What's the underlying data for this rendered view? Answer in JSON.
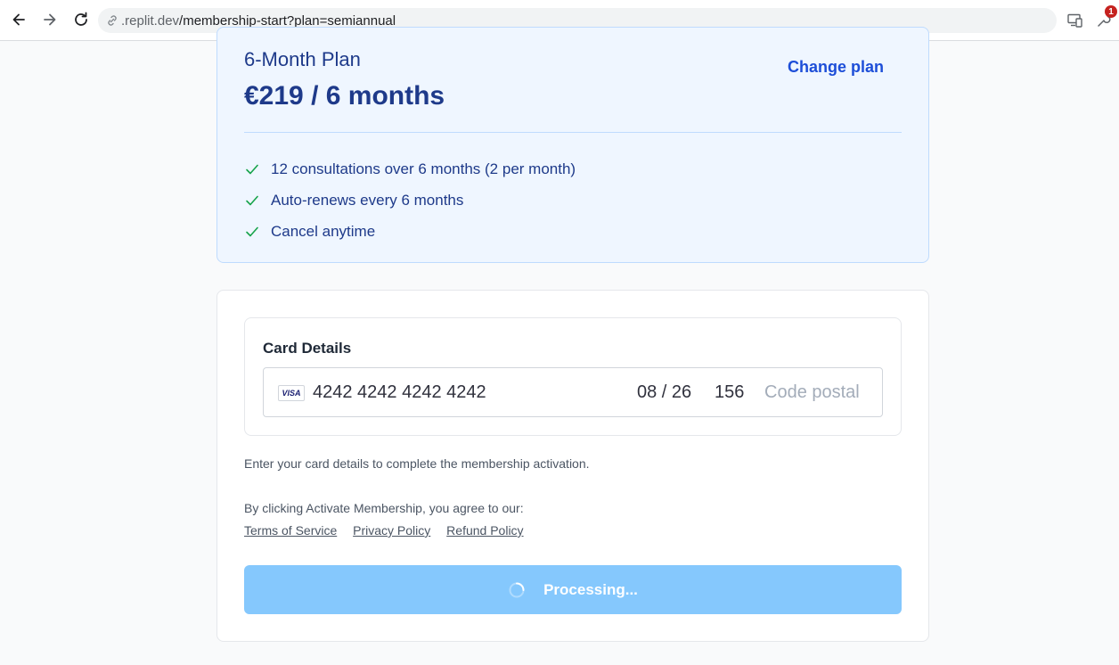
{
  "browser": {
    "url_host": ".replit.dev",
    "url_path": "/membership-start?plan=semiannual",
    "extension_badge": "1",
    "icons": [
      "back-icon",
      "forward-icon",
      "reload-icon",
      "link-icon",
      "devices-icon",
      "extension-icon"
    ]
  },
  "plan": {
    "name": "6-Month Plan",
    "price": "€219 / 6 months",
    "change_label": "Change plan",
    "features": [
      {
        "text": "12 consultations over 6 months (2 per month)"
      },
      {
        "text": "Auto-renews every 6 months"
      },
      {
        "text": "Cancel anytime"
      }
    ]
  },
  "payment": {
    "card_details_title": "Card Details",
    "card_brand": "VISA",
    "card_number": "4242 4242 4242 4242",
    "expiry": "08 / 26",
    "cvc": "156",
    "postal_placeholder": "Code postal",
    "hint": "Enter your card details to complete the membership activation.",
    "agree_text": "By clicking Activate Membership, you agree to our:",
    "links": {
      "terms": "Terms of Service",
      "privacy": "Privacy Policy",
      "refund": "Refund Policy"
    },
    "submit_label": "Processing..."
  },
  "colors": {
    "plan_bg": "#eff6ff",
    "plan_text": "#1e3a8a",
    "check": "#16a34a",
    "submit_bg": "#85c8fd"
  }
}
